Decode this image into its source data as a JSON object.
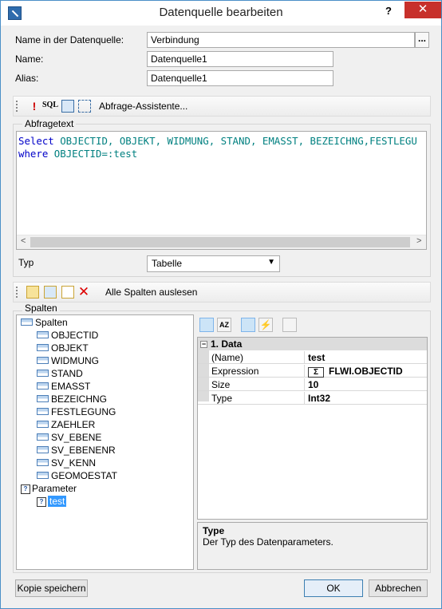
{
  "window": {
    "title": "Datenquelle bearbeiten",
    "help": "?",
    "close": "✕"
  },
  "form": {
    "datasource_label": "Name in der Datenquelle:",
    "datasource_value": "Verbindung",
    "browse_label": "...",
    "name_label": "Name:",
    "name_value": "Datenquelle1",
    "alias_label": "Alias:",
    "alias_value": "Datenquelle1"
  },
  "query_toolbar": {
    "sql_label": "SQL",
    "wizard_label": "Abfrage-Assistente..."
  },
  "query": {
    "group_label": "Abfragetext",
    "line1_kw": "Select",
    "line1_rest": " OBJECTID, OBJEKT, WIDMUNG, STAND, EMASST, BEZEICHNG,FESTLEGU",
    "line2_kw": "where",
    "line2_rest": " OBJECTID=:test"
  },
  "type": {
    "label": "Typ",
    "value": "Tabelle"
  },
  "columns_toolbar": {
    "read_all_label": "Alle Spalten auslesen"
  },
  "columns": {
    "group_label": "Spalten",
    "root_label": "Spalten",
    "items": [
      "OBJECTID",
      "OBJEKT",
      "WIDMUNG",
      "STAND",
      "EMASST",
      "BEZEICHNG",
      "FESTLEGUNG",
      "ZAEHLER",
      "SV_EBENE",
      "SV_EBENENR",
      "SV_KENN",
      "GEOMOESTAT"
    ],
    "param_root_label": "Parameter",
    "param_items": [
      "test"
    ]
  },
  "properties": {
    "category": "1. Data",
    "rows": [
      {
        "name": "(Name)",
        "value": "test"
      },
      {
        "name": "Expression",
        "value": "FLWI.OBJECTID"
      },
      {
        "name": "Size",
        "value": "10"
      },
      {
        "name": "Type",
        "value": "Int32"
      }
    ],
    "desc_title": "Type",
    "desc_text": "Der Typ des Datenparameters."
  },
  "buttons": {
    "save_copy": "Kopie speichern",
    "ok": "OK",
    "cancel": "Abbrechen"
  }
}
